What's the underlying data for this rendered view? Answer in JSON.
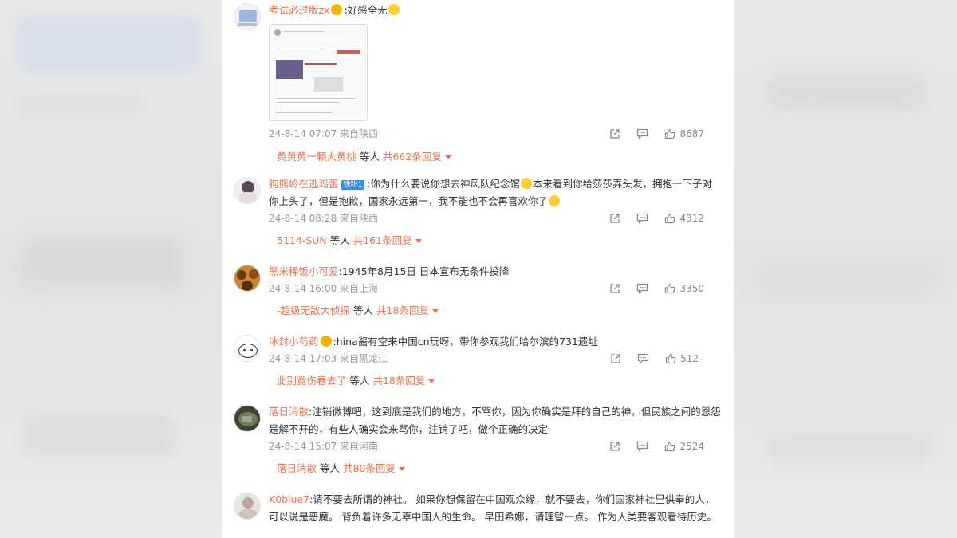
{
  "comments": [
    {
      "user": "考试必过版zx",
      "has_badge": true,
      "text": ":好感全无",
      "has_image": true,
      "time": "24-8-14 07:07 来自陕西",
      "likes": "8687",
      "reply_user": "黄黄黄一颗大黄桃",
      "reply_mid": " 等人 ",
      "reply_count": "共662条回复"
    },
    {
      "user": "狗熊岭在逃鸡蛋",
      "vip": "铁粉1",
      "text": ":你为什么要说你想去神风队纪念馆",
      "text2": "本来看到你给莎莎弄头发，拥抱一下子对你上头了，但是抱歉，国家永远第一，我不能也不会再喜欢你了",
      "time": "24-8-14 08:28 来自陕西",
      "likes": "4312",
      "reply_user": "5114-SUN",
      "reply_mid": " 等人 ",
      "reply_count": "共161条回复"
    },
    {
      "user": "黑米稀饭小可爱",
      "text": ":1945年8月15日 日本宣布无条件投降",
      "time": "24-8-14 16:00 来自上海",
      "likes": "3350",
      "reply_user": "-超级无敌大侦探",
      "reply_mid": " 等人 ",
      "reply_count": "共18条回复"
    },
    {
      "user": "冰封小芍药",
      "has_badge": true,
      "text": ":hina酱有空来中国cn玩呀，带你参观我们哈尔滨的731遗址",
      "time": "24-8-14 17:03 来自黑龙江",
      "likes": "512",
      "reply_user": "此别竟伤春去了",
      "reply_mid": " 等人 ",
      "reply_count": "共18条回复"
    },
    {
      "user": "落日消散",
      "text": ":注销微博吧，这到底是我们的地方，不骂你，因为你确实是拜的自己的神，但民族之间的恩怨是解不开的，有些人确实会来骂你，注销了吧，做个正确的决定",
      "time": "24-8-14 15:07 来自河南",
      "likes": "2524",
      "reply_user": "落日消散",
      "reply_mid": " 等人 ",
      "reply_count": "共80条回复"
    },
    {
      "user": "K0blue7",
      "text": ":请不要去所谓的神社。 如果你想保留在中国观众缘，就不要去，你们国家神社里供奉的人，可以说是恶魔。 背负着许多无辜中国人的生命。 早田希娜，请理智一点。 作为人类要客观看待历史。"
    }
  ],
  "colors": {
    "accent": "#eb7350",
    "meta": "#999999",
    "text": "#333333"
  },
  "icons": [
    "share-icon",
    "comment-icon",
    "like-icon",
    "avatar",
    "crown-badge-icon",
    "vip-badge"
  ]
}
